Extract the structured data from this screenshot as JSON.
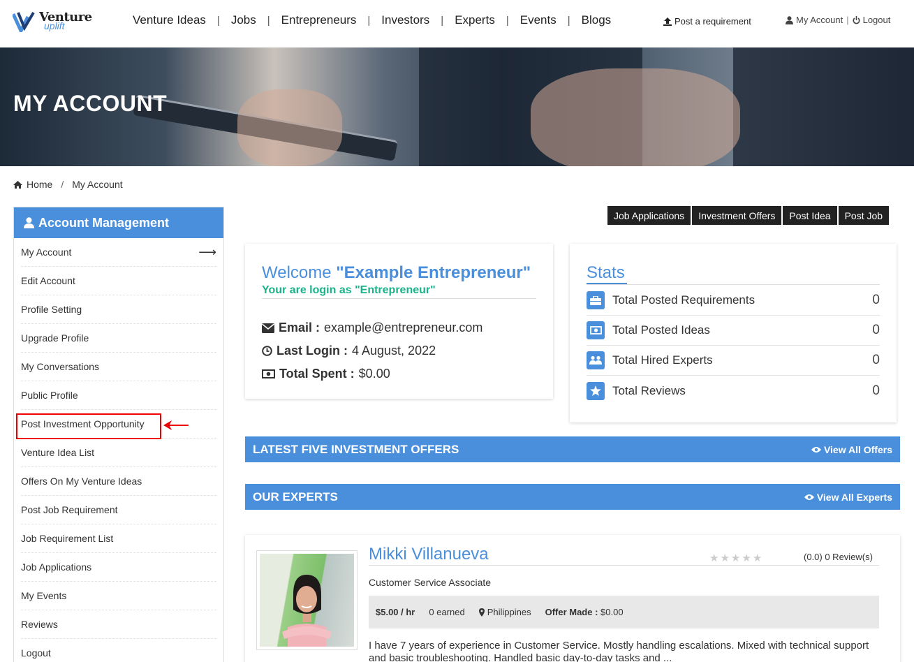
{
  "brand": {
    "name_top": "Venture",
    "name_bottom": "uplift",
    "accent": "#4a8fdc"
  },
  "nav": [
    "Venture Ideas",
    "Jobs",
    "Entrepreneurs",
    "Investors",
    "Experts",
    "Events",
    "Blogs"
  ],
  "header": {
    "post_requirement": "Post a requirement",
    "my_account": "My Account",
    "logout": "Logout"
  },
  "banner": {
    "title": "MY ACCOUNT"
  },
  "breadcrumb": {
    "home": "Home",
    "current": "My Account"
  },
  "sidebar": {
    "title": "Account Management",
    "items": [
      "My Account",
      "Edit Account",
      "Profile Setting",
      "Upgrade Profile",
      "My Conversations",
      "Public Profile",
      "Post Investment Opportunity",
      "Venture Idea List",
      "Offers On My Venture Ideas",
      "Post Job Requirement",
      "Job Requirement List",
      "Job Applications",
      "My Events",
      "Reviews",
      "Logout"
    ],
    "active_index": 0,
    "highlighted_index": 6
  },
  "top_buttons": [
    "Job Applications",
    "Investment Offers",
    "Post Idea",
    "Post Job"
  ],
  "welcome": {
    "greeting": "Welcome",
    "name": "\"Example Entrepreneur\"",
    "role": "Your are login as \"Entrepreneur\"",
    "email_label": "Email :",
    "email": "example@entrepreneur.com",
    "login_label": "Last Login :",
    "login": "4 August, 2022",
    "spent_label": "Total Spent :",
    "spent": "$0.00"
  },
  "stats": {
    "title": "Stats",
    "rows": [
      {
        "label": "Total Posted Requirements",
        "value": "0",
        "icon": "briefcase-icon"
      },
      {
        "label": "Total Posted Ideas",
        "value": "0",
        "icon": "money-icon"
      },
      {
        "label": "Total Hired Experts",
        "value": "0",
        "icon": "users-icon"
      },
      {
        "label": "Total Reviews",
        "value": "0",
        "icon": "star-icon"
      }
    ]
  },
  "offers_bar": {
    "title": "LATEST FIVE INVESTMENT OFFERS",
    "link": "View All Offers"
  },
  "experts_bar": {
    "title": "OUR EXPERTS",
    "link": "View All Experts"
  },
  "expert": {
    "name": "Mikki Villanueva",
    "rating": 0,
    "reviews": "(0.0) 0 Review(s)",
    "title": "Customer Service Associate",
    "rate": "$5.00 / hr",
    "earned": "0 earned",
    "location": "Philippines",
    "offer_label": "Offer Made :",
    "offer": "$0.00",
    "bio": "I have 7 years of experience in Customer Service. Mostly handling escalations. Mixed with technical support and basic troubleshooting. Handled basic day-to-day tasks and ..."
  }
}
